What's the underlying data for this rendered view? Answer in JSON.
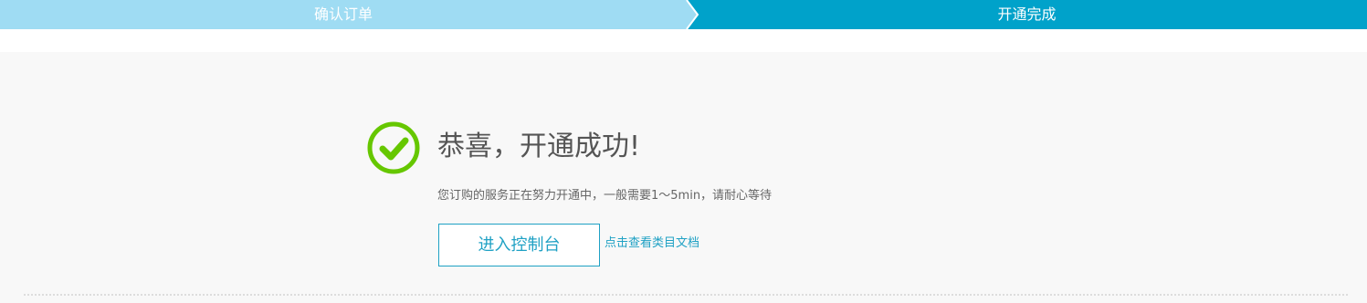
{
  "steps": [
    {
      "label": "确认订单",
      "state": "done"
    },
    {
      "label": "开通完成",
      "state": "active"
    }
  ],
  "result": {
    "icon": "check-circle-icon",
    "title": "恭喜，开通成功!",
    "description": "您订购的服务正在努力开通中，一般需要1～5min，请耐心等待"
  },
  "actions": {
    "console_button": "进入控制台",
    "docs_link": "点击查看类目文档"
  },
  "colors": {
    "step_done": "#9fdcf3",
    "step_active": "#00a2ca",
    "accent": "#1fa1c4",
    "success": "#66c700"
  }
}
